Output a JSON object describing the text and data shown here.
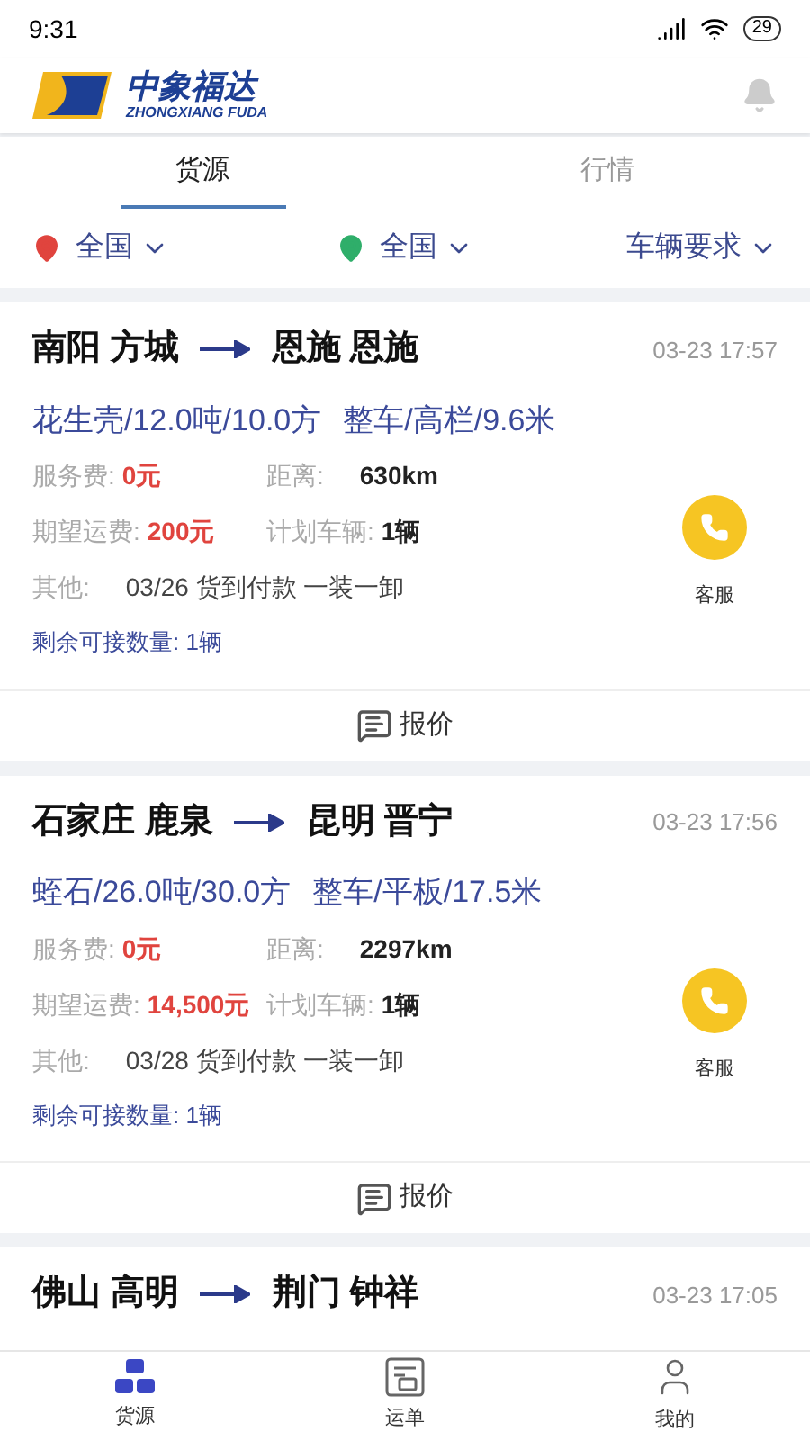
{
  "status_bar": {
    "time": "9:31",
    "battery": "29"
  },
  "header": {
    "logo_cn": "中象福达",
    "logo_en": "ZHONGXIANG FUDA"
  },
  "tabs": [
    {
      "label": "货源",
      "selected": true
    },
    {
      "label": "行情",
      "selected": false
    }
  ],
  "filters": [
    {
      "kind": "origin",
      "label": "全国"
    },
    {
      "kind": "destination",
      "label": "全国"
    },
    {
      "kind": "plain",
      "label": "车辆要求"
    }
  ],
  "cards": [
    {
      "from": "南阳 方城",
      "to": "恩施 恩施",
      "time": "03-23 17:57",
      "cargo": "花生壳/12.0吨/10.0方",
      "truck": "整车/高栏/9.6米",
      "fee_label": "服务费:",
      "fee": "0元",
      "distance_label": "距离:",
      "distance": "630km",
      "freight_label": "期望运费:",
      "freight": "200元",
      "vehicles_label": "计划车辆:",
      "vehicles": "1辆",
      "other_label": "其他:",
      "other": "03/26 货到付款 一装一卸",
      "remaining": "剩余可接数量: 1辆",
      "service": "客服",
      "quote": "报价"
    },
    {
      "from": "石家庄 鹿泉",
      "to": "昆明 晋宁",
      "time": "03-23 17:56",
      "cargo": "蛭石/26.0吨/30.0方",
      "truck": "整车/平板/17.5米",
      "fee_label": "服务费:",
      "fee": "0元",
      "distance_label": "距离:",
      "distance": "2297km",
      "freight_label": "期望运费:",
      "freight": "14,500元",
      "vehicles_label": "计划车辆:",
      "vehicles": "1辆",
      "other_label": "其他:",
      "other": "03/28 货到付款 一装一卸",
      "remaining": "剩余可接数量: 1辆",
      "service": "客服",
      "quote": "报价"
    },
    {
      "from": "佛山 高明",
      "to": "荆门 钟祥",
      "time": "03-23 17:05"
    }
  ],
  "bottom_nav": [
    {
      "label": "货源",
      "selected": true,
      "kind": "boxes"
    },
    {
      "label": "运单",
      "selected": false,
      "kind": "waybill"
    },
    {
      "label": "我的",
      "selected": false,
      "kind": "user"
    }
  ]
}
